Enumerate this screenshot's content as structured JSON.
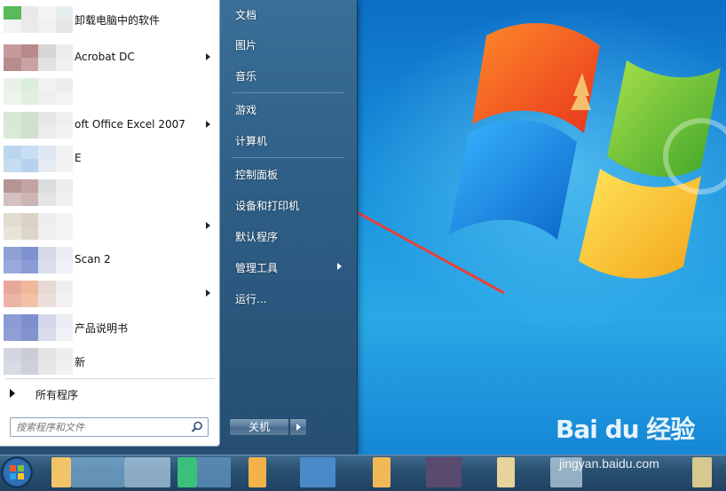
{
  "start_menu": {
    "programs": [
      {
        "label": "卸载电脑中的软件",
        "prefix": "█",
        "has_arrow": false,
        "colors": [
          "#5ab95a",
          "#e9e9e9",
          "#f4f4f4",
          "#e7ecef",
          "#f3f3f3",
          "#eaeaea",
          "#f1f1f1",
          "#e6e6e6"
        ]
      },
      {
        "label": "Acrobat DC",
        "has_arrow": true,
        "colors": [
          "#c69a9a",
          "#b88a8a",
          "#d6d6d6",
          "#ececec",
          "#b98b8b",
          "#c9a3a3",
          "#e2e2e2",
          "#f0f0f0"
        ]
      },
      {
        "label": "",
        "has_arrow": false,
        "colors": [
          "#e8f2e6",
          "#dceede",
          "#f2f2f2",
          "#ececec",
          "#edf5ea",
          "#e2efe0",
          "#efefef",
          "#f3f3f3"
        ]
      },
      {
        "label": "oft Office Excel 2007",
        "has_arrow": true,
        "colors": [
          "#d9e8d6",
          "#cfe2cb",
          "#e7e7e7",
          "#efefef",
          "#dbe9d8",
          "#cfe1cc",
          "#ececec",
          "#f2f2f2"
        ]
      },
      {
        "label": "E",
        "has_arrow": false,
        "colors": [
          "#b9d5ef",
          "#c8def2",
          "#dfe8f1",
          "#eef2f5",
          "#c6dcf0",
          "#b7d2ee",
          "#e5ebf0",
          "#f2f2f2"
        ]
      },
      {
        "label": "",
        "has_arrow": false,
        "colors": [
          "#b49595",
          "#c3a3a3",
          "#dcdcdc",
          "#ededed",
          "#d5c0c0",
          "#cdb5b5",
          "#e4e4e4",
          "#f0f0f0"
        ]
      },
      {
        "label": "",
        "has_arrow": true,
        "colors": [
          "#e2dccf",
          "#d9d3c4",
          "#eeeeee",
          "#f4f4f4",
          "#e8e4da",
          "#dcd6ca",
          "#efefef",
          "#f5f5f5"
        ]
      },
      {
        "label": "Scan 2",
        "has_arrow": false,
        "colors": [
          "#8fa0d6",
          "#7f92cf",
          "#d5d9ea",
          "#eceef4",
          "#9aa9db",
          "#8b9cd4",
          "#dadeee",
          "#f0f1f6"
        ]
      },
      {
        "label": "",
        "has_arrow": true,
        "colors": [
          "#e8a89a",
          "#f0b89b",
          "#e8d9d6",
          "#efefef",
          "#ecb4a6",
          "#f2c2a8",
          "#ebdfdc",
          "#f2f2f2"
        ]
      },
      {
        "label": "产品说明书",
        "has_arrow": false,
        "colors": [
          "#8c9bd3",
          "#7d8ecd",
          "#d3d7e9",
          "#eceef4",
          "#8f9ed5",
          "#8293cf",
          "#d8dcec",
          "#f0f1f6"
        ]
      },
      {
        "label": "新",
        "has_arrow": false,
        "colors": [
          "#d3d6df",
          "#c9cdd8",
          "#e3e3e3",
          "#eeeeee",
          "#d8dbe3",
          "#cdd0da",
          "#e6e6e6",
          "#f1f1f1"
        ]
      }
    ],
    "all_programs": "所有程序",
    "search_placeholder": "搜索程序和文件",
    "right_items": [
      {
        "label": "文档",
        "has_arrow": false
      },
      {
        "label": "图片",
        "has_arrow": false
      },
      {
        "label": "音乐",
        "has_arrow": false
      },
      {
        "label": "游戏",
        "has_arrow": false
      },
      {
        "label": "计算机",
        "has_arrow": false
      },
      {
        "label": "控制面板",
        "has_arrow": false
      },
      {
        "label": "设备和打印机",
        "has_arrow": false
      },
      {
        "label": "默认程序",
        "has_arrow": false
      },
      {
        "label": "管理工具",
        "has_arrow": true
      },
      {
        "label": "运行...",
        "has_arrow": false
      }
    ],
    "shutdown_label": "关机"
  },
  "watermark": {
    "logo": "Bai du 经验",
    "url": "jingyan.baidu.com"
  },
  "colors": {
    "annotation_arrow": "#e8403a",
    "menu_blue": "#2f5f86",
    "desktop_blue": "#1b95de"
  }
}
